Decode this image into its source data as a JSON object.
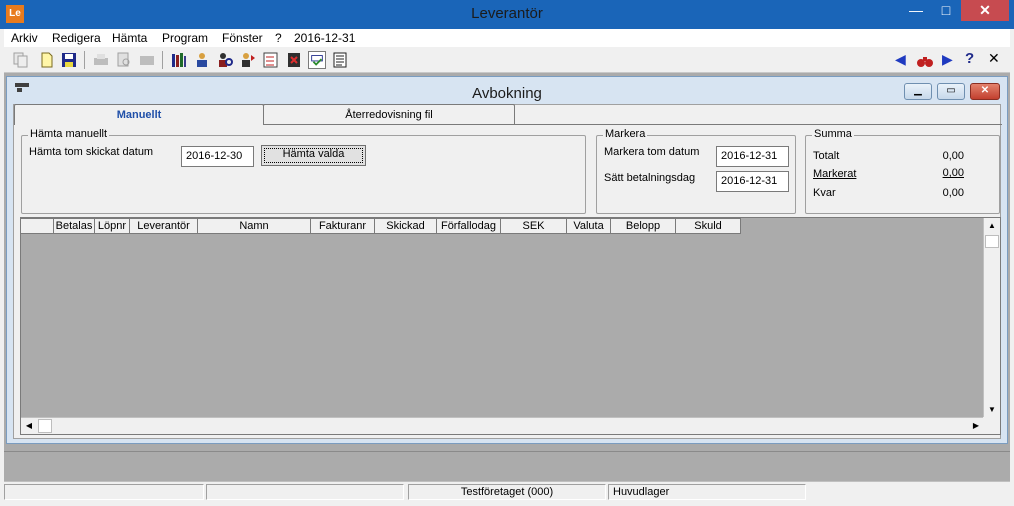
{
  "app": {
    "title": "Leverantör",
    "logo": "Le",
    "controls": {
      "minimize": "—",
      "maximize": "□",
      "close": "✕"
    }
  },
  "menu": [
    "Arkiv",
    "Redigera",
    "Hämta",
    "Program",
    "Fönster",
    "?",
    "2016-12-31"
  ],
  "toolbar": {
    "icons": [
      "copy-icon",
      "new-document-icon",
      "save-icon",
      "print-icon",
      "print-preview-icon",
      "print-setup-icon",
      "books-icon",
      "person-ledger-icon",
      "person-search-icon",
      "checklist-icon",
      "calculator-icon",
      "checkmark-icon",
      "document-list-icon"
    ],
    "nav": {
      "prev": "◀",
      "find": "binoculars-icon",
      "next": "▶",
      "help": "?",
      "close": "✕"
    }
  },
  "window": {
    "title": "Avbokning",
    "controls": {
      "minimize": "▁",
      "maximize": "▭",
      "close": "✕"
    }
  },
  "tabs": [
    {
      "label": "Manuellt",
      "active": true
    },
    {
      "label": "Återredovisning fil",
      "active": false
    }
  ],
  "hamta": {
    "legend": "Hämta manuellt",
    "date_label": "Hämta tom skickat datum",
    "date_value": "2016-12-30",
    "button": "Hämta valda"
  },
  "markera": {
    "legend": "Markera",
    "date_label": "Markera tom datum",
    "date_value": "2016-12-31",
    "pay_label": "Sätt betalningsdag",
    "pay_value": "2016-12-31"
  },
  "summa": {
    "legend": "Summa",
    "rows": [
      {
        "label": "Totalt",
        "value": "0,00"
      },
      {
        "label": "Markerat",
        "value": "0,00"
      },
      {
        "label": "Kvar",
        "value": "0,00"
      }
    ]
  },
  "grid": {
    "columns": [
      "",
      "Betalas",
      "Löpnr",
      "Leverantör",
      "Namn",
      "Fakturanr",
      "Skickad",
      "Förfallodag",
      "SEK",
      "Valuta",
      "Belopp",
      "Skuld"
    ],
    "scroll": {
      "up": "▲",
      "down": "▼",
      "left": "◀",
      "right": "▶"
    }
  },
  "status": [
    "",
    "",
    "Testföretaget (000)",
    "Huvudlager"
  ]
}
